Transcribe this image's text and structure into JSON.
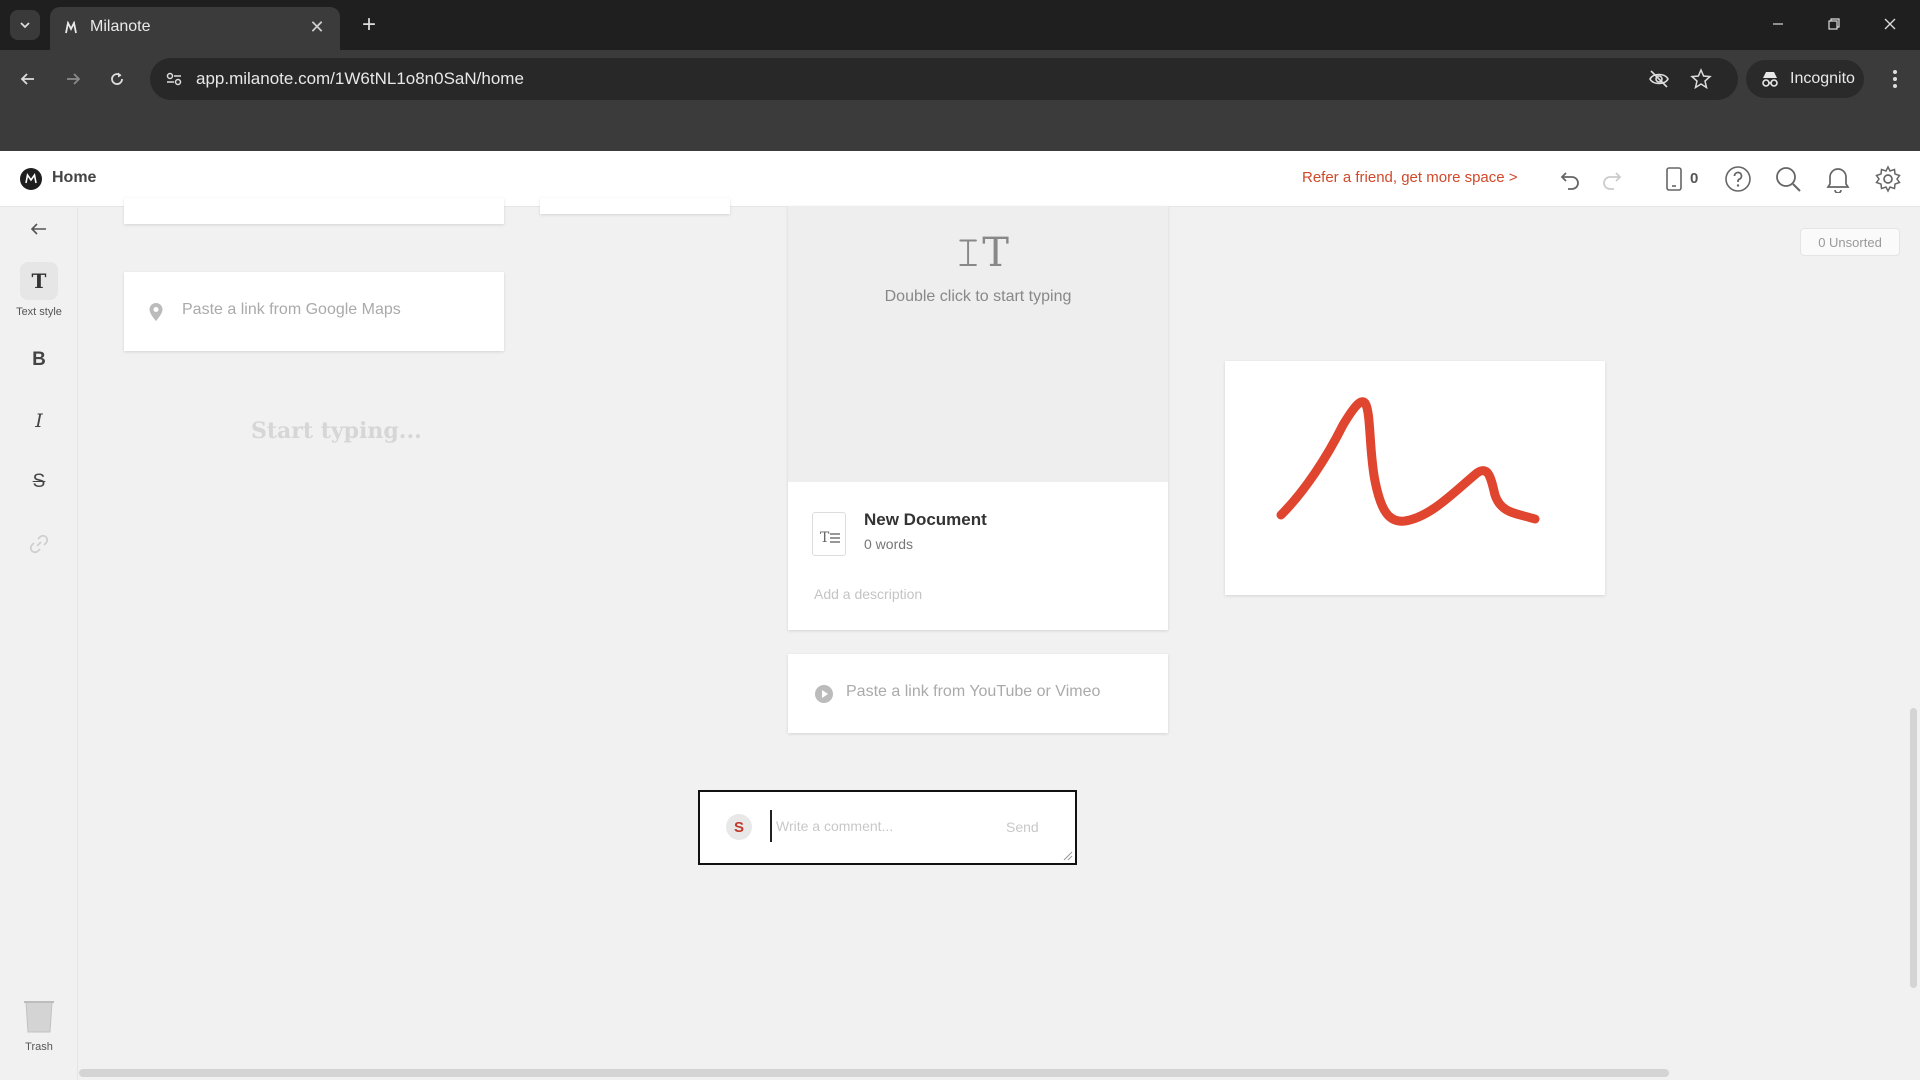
{
  "browser": {
    "tab_title": "Milanote",
    "url": "app.milanote.com/1W6tNL1o8n0SaN/home",
    "profile_label": "Incognito"
  },
  "header": {
    "home_label": "Home",
    "refer_link": "Refer a friend, get more space >",
    "device_count": "0"
  },
  "rail": {
    "text_style_label": "Text style",
    "text_style_glyph": "T",
    "bold_glyph": "B",
    "italic_glyph": "I",
    "strike_glyph": "S",
    "trash_label": "Trash"
  },
  "canvas": {
    "map_placeholder": "Paste a link from Google Maps",
    "start_typing": "Start typing...",
    "video_placeholder": "Paste a link from YouTube or Vimeo",
    "unsorted_label": "0 Unsorted",
    "document": {
      "hint": "Double click to start typing",
      "title": "New Document",
      "word_count": "0 words",
      "description_placeholder": "Add a description"
    },
    "comment": {
      "avatar_initial": "S",
      "placeholder": "Write a comment...",
      "send_label": "Send"
    },
    "sketch_color": "#e0462f"
  },
  "colors": {
    "accent": "#d0492b"
  }
}
